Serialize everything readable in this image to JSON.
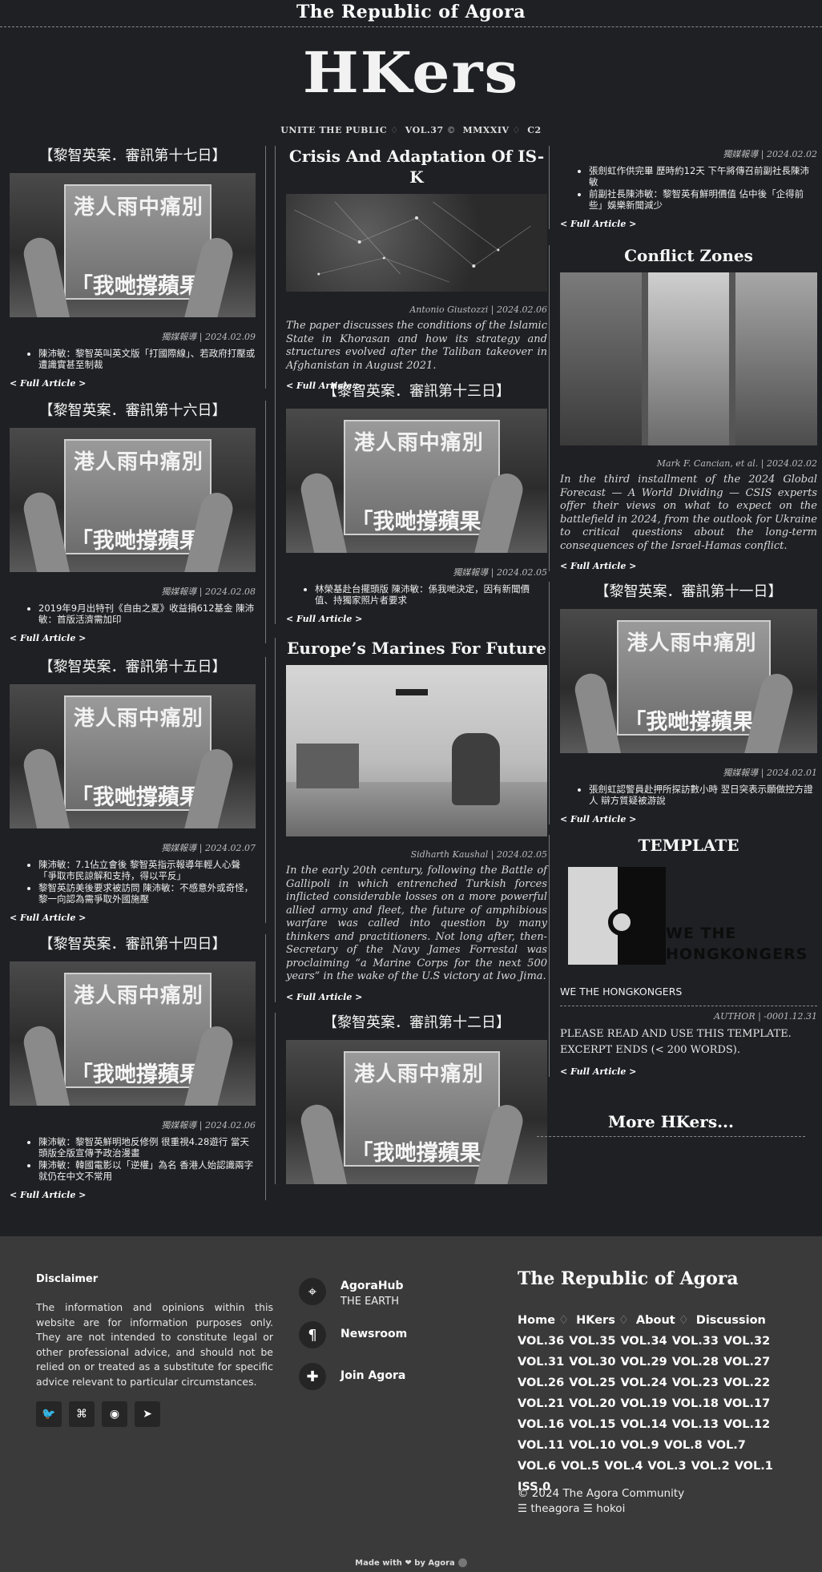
{
  "site": {
    "title": "The Republic of Agora",
    "logo": "HKers",
    "edition": [
      "UNITE THE PUBLIC",
      "VOL.37",
      "MMXXIV",
      "C2"
    ]
  },
  "col1": [
    {
      "title": "【黎智英案．審訊第十七日】",
      "meta": "獨媒報導 | 2024.02.09",
      "bullets": [
        "陳沛敏：黎智英叫英文版「打國際線」、若政府打壓或遭識實甚至制裁"
      ],
      "link": "< Full Article >"
    },
    {
      "title": "【黎智英案．審訊第十六日】",
      "meta": "獨媒報導 | 2024.02.08",
      "bullets": [
        "2019年9月出特刊《自由之夏》收益捐612基金 陳沛敏：首版活濟需加印"
      ],
      "link": "< Full Article >"
    },
    {
      "title": "【黎智英案．審訊第十五日】",
      "meta": "獨媒報導 | 2024.02.07",
      "bullets": [
        "陳沛敏：7.1佔立會後 黎智英指示報導年輕人心聲「爭取市民諒解和支持，得以平反」",
        "黎智英訪美後要求被訪問 陳沛敏：不感意外或奇怪，黎一向認為需爭取外國施壓"
      ],
      "link": "< Full Article >"
    },
    {
      "title": "【黎智英案．審訊第十四日】",
      "meta": "獨媒報導 | 2024.02.06",
      "bullets": [
        "陳沛敏：黎智英鮮明地反修例 很重視4.28遊行 當天頭版全版宣傳予政治漫畫",
        "陳沛敏：韓國電影以「逆權」為名 香港人始認識兩字就仍在中文不常用"
      ],
      "link": "< Full Article >"
    }
  ],
  "col2": [
    {
      "title": "Crisis And Adaptation Of IS-K",
      "meta": "Antonio Giustozzi | 2024.02.06",
      "excerpt": "The paper discusses the conditions of the Islamic State in Khorasan and how its strategy and structures evolved after the Taliban takeover in Afghanistan in August 2021.",
      "link": "< Full Article >"
    },
    {
      "title": "【黎智英案．審訊第十三日】",
      "meta": "獨媒報導 | 2024.02.05",
      "bullets": [
        "林榮基赴台擺頭版 陳沛敏：係我哋決定，因有新聞價值、持獨家照片者要求"
      ],
      "link": "< Full Article >"
    },
    {
      "title": "Europe’s Marines For Future",
      "meta": "Sidharth Kaushal | 2024.02.05",
      "excerpt": "In the early 20th century, following the Battle of Gallipoli in which entrenched Turkish forces inflicted considerable losses on a more powerful allied army and fleet, the future of amphibious warfare was called into question by many thinkers and practitioners. Not long after, then-Secretary of the Navy James Forrestal was proclaiming “a Marine Corps for the next 500 years” in the wake of the U.S victory at Iwo Jima.",
      "link": "< Full Article >"
    },
    {
      "title": "【黎智英案．審訊第十二日】"
    }
  ],
  "col3": [
    {
      "meta": "獨媒報導 | 2024.02.02",
      "bullets": [
        "張劍虹作供完畢 歷時約12天 下午將傳召前副社長陳沛敏",
        "前副社長陳沛敏：黎智英有鮮明價值 佔中後「企得前些」娛樂新聞減少"
      ],
      "link": "< Full Article >"
    },
    {
      "title": "Conflict Zones",
      "meta": "Mark F. Cancian, et al. | 2024.02.02",
      "excerpt": "In the third installment of the 2024 Global Forecast — A World Dividing — CSIS experts offer their views on what to expect on the battlefield in 2024, from the outlook for Ukraine to critical questions about the long-term consequences of the Israel-Hamas conflict.",
      "link": "< Full Article >"
    },
    {
      "title": "【黎智英案．審訊第十一日】",
      "meta": "獨媒報導 | 2024.02.01",
      "bullets": [
        "張劍虹認警員赴押所探訪數小時 翌日突表示願做控方證人 辯方質疑被游說"
      ],
      "link": "< Full Article >"
    },
    {
      "title": "TEMPLATE",
      "image_text": [
        "WE THE",
        "HONGKONGERS"
      ],
      "caption": "WE THE HONGKONGERS",
      "meta": "AUTHOR | -0001.12.31",
      "excerpt_lines": [
        "PLEASE READ AND USE THIS TEMPLATE.",
        "EXCERPT ENDS (< 200 WORDS)."
      ],
      "link": "< Full Article >"
    }
  ],
  "news_image_text": {
    "top": "港人雨中痛別",
    "bottom": "「我哋撐蘋果"
  },
  "more": "More HKers...",
  "footer": {
    "disclaimer_title": "Disclaimer",
    "disclaimer_text": "The information and opinions within this website are for information purposes only. They are not intended to constitute legal or other professional advice, and should not be relied on or treated as a substitute for specific advice relevant to particular circumstances.",
    "socials": [
      "twitter-icon",
      "github-icon",
      "reddit-icon",
      "telegram-icon"
    ],
    "contacts": [
      {
        "title": "AgoraHub",
        "subtitle": "THE EARTH",
        "icon": "location-pin-icon"
      },
      {
        "title": "Newsroom",
        "icon": "pilcrow-icon"
      },
      {
        "title": "Join Agora",
        "icon": "puzzle-icon"
      }
    ],
    "republic_title": "The Republic of Agora",
    "nav": [
      "Home",
      "HKers",
      "About",
      "Discussion"
    ],
    "vols": [
      "VOL.36",
      "VOL.35",
      "VOL.34",
      "VOL.33",
      "VOL.32",
      "VOL.31",
      "VOL.30",
      "VOL.29",
      "VOL.28",
      "VOL.27",
      "VOL.26",
      "VOL.25",
      "VOL.24",
      "VOL.23",
      "VOL.22",
      "VOL.21",
      "VOL.20",
      "VOL.19",
      "VOL.18",
      "VOL.17",
      "VOL.16",
      "VOL.15",
      "VOL.14",
      "VOL.13",
      "VOL.12",
      "VOL.11",
      "VOL.10",
      "VOL.9",
      "VOL.8",
      "VOL.7",
      "VOL.6",
      "VOL.5",
      "VOL.4",
      "VOL.3",
      "VOL.2",
      "VOL.1",
      "ISS.0"
    ],
    "copyright": "© 2024 The Agora Community",
    "credits": "☰ theagora ☰ hokoi",
    "made_with": "Made with ❤ by Agora"
  },
  "colors": {
    "background": "#1f2024",
    "footer": "#3a3a3a",
    "text": "#e9e9e9"
  }
}
